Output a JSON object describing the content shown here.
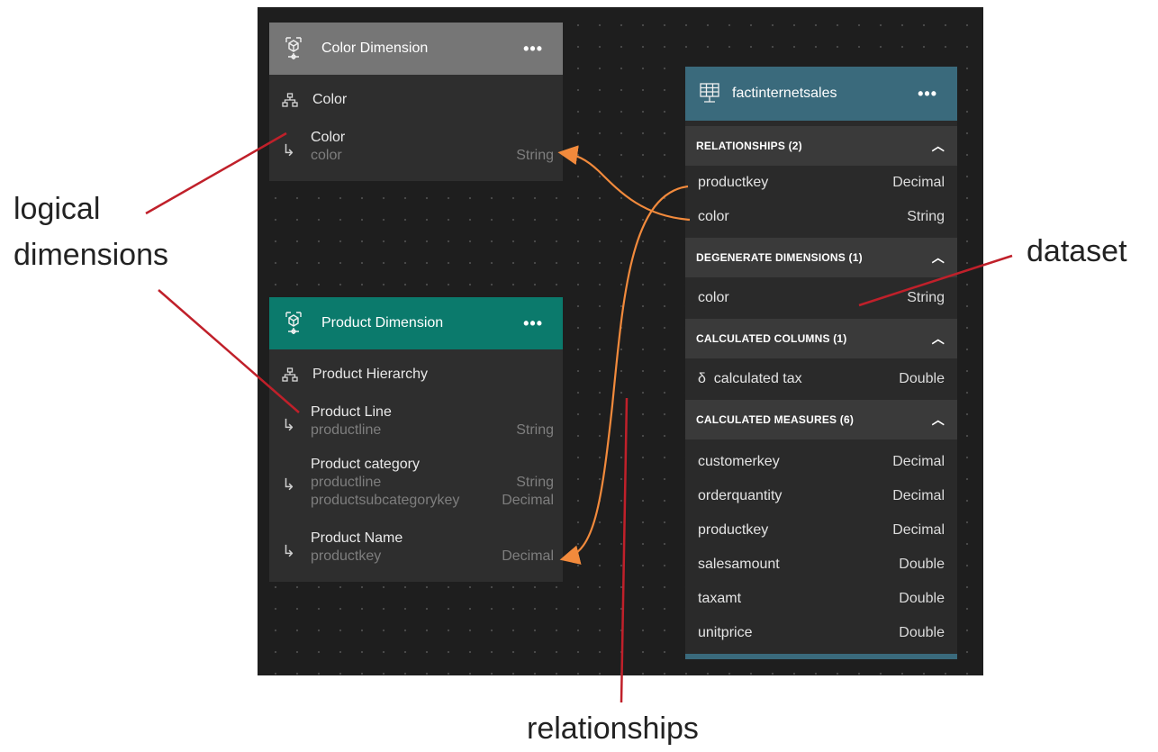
{
  "color_dimension": {
    "title": "Color Dimension",
    "more": "•••",
    "hierarchy": "Color",
    "level": {
      "name": "Color",
      "column": "color",
      "type": "String"
    },
    "header_color": "#767676"
  },
  "product_dimension": {
    "title": "Product Dimension",
    "more": "•••",
    "hierarchy": "Product Hierarchy",
    "header_color": "#0b7a6c",
    "levels": [
      {
        "name": "Product Line",
        "columns": [
          {
            "column": "productline",
            "type": "String"
          }
        ]
      },
      {
        "name": "Product category",
        "columns": [
          {
            "column": "productline",
            "type": "String"
          },
          {
            "column": "productsubcategorykey",
            "type": "Decimal"
          }
        ]
      },
      {
        "name": "Product Name",
        "columns": [
          {
            "column": "productkey",
            "type": "Decimal"
          }
        ]
      }
    ]
  },
  "dataset": {
    "title": "factinternetsales",
    "more": "•••",
    "header_color": "#3a6a7c",
    "relationships": {
      "title": "RELATIONSHIPS (2)",
      "items": [
        {
          "name": "productkey",
          "type": "Decimal"
        },
        {
          "name": "color",
          "type": "String"
        }
      ]
    },
    "degenerate_dimensions": {
      "title": "DEGENERATE DIMENSIONS (1)",
      "items": [
        {
          "name": "color",
          "type": "String"
        }
      ]
    },
    "calculated_columns": {
      "title": "CALCULATED COLUMNS (1)",
      "items": [
        {
          "prefix": "δ",
          "name": "calculated tax",
          "type": "Double"
        }
      ]
    },
    "calculated_measures": {
      "title": "CALCULATED MEASURES (6)",
      "items": [
        {
          "name": "customerkey",
          "type": "Decimal"
        },
        {
          "name": "orderquantity",
          "type": "Decimal"
        },
        {
          "name": "productkey",
          "type": "Decimal"
        },
        {
          "name": "salesamount",
          "type": "Double"
        },
        {
          "name": "taxamt",
          "type": "Double"
        },
        {
          "name": "unitprice",
          "type": "Double"
        }
      ]
    }
  },
  "annotations": {
    "logical_1": "logical",
    "logical_2": "dimensions",
    "dataset": "dataset",
    "relationships": "relationships"
  },
  "colors": {
    "canvas": "#1e1e1e",
    "card": "#2e2e2e",
    "section": "#3a3a3a",
    "relationship_line": "#f28a3c",
    "annotation_line": "#c0202a"
  },
  "icons": [
    "cube-dimension-icon",
    "hierarchy-icon",
    "level-arrow-icon",
    "table-dataset-icon",
    "chevron-up-icon",
    "more-icon"
  ]
}
